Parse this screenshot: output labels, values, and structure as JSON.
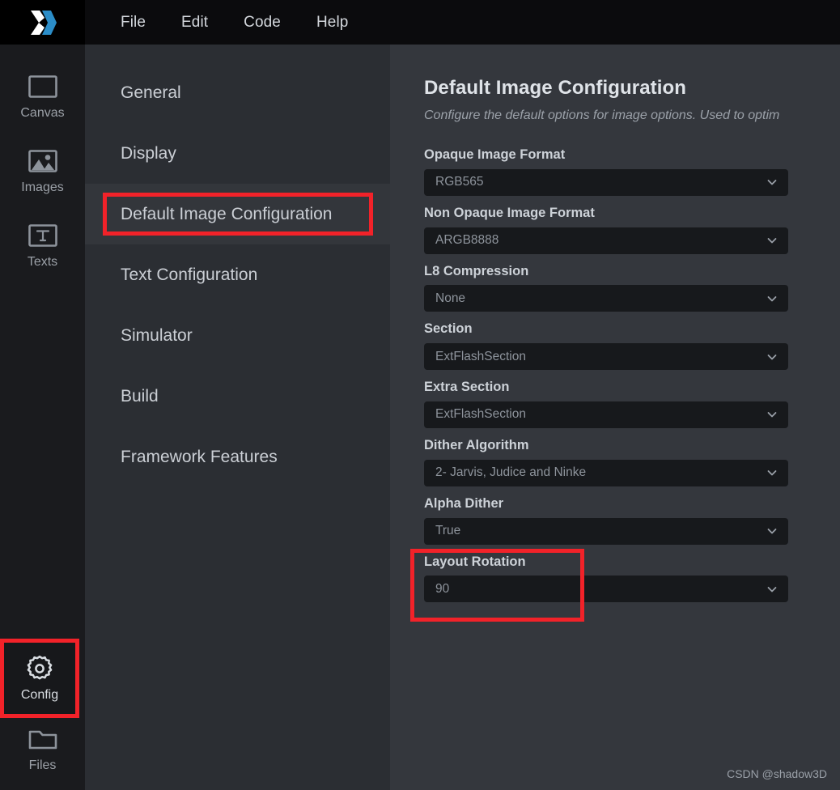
{
  "app": {
    "logo_icon": "x-logo-icon",
    "menu": [
      {
        "label": "File"
      },
      {
        "label": "Edit"
      },
      {
        "label": "Code"
      },
      {
        "label": "Help"
      }
    ]
  },
  "rail": {
    "top_items": [
      {
        "label": "Canvas",
        "icon": "canvas-rect-icon"
      },
      {
        "label": "Images",
        "icon": "image-picture-icon"
      },
      {
        "label": "Texts",
        "icon": "text-t-icon"
      }
    ],
    "bottom_items": [
      {
        "label": "Config",
        "icon": "gear-icon"
      },
      {
        "label": "Files",
        "icon": "folder-icon"
      }
    ]
  },
  "nav": {
    "items": [
      {
        "label": "General"
      },
      {
        "label": "Display"
      },
      {
        "label": "Default Image Configuration"
      },
      {
        "label": "Text Configuration"
      },
      {
        "label": "Simulator"
      },
      {
        "label": "Build"
      },
      {
        "label": "Framework Features"
      }
    ]
  },
  "content": {
    "title": "Default Image Configuration",
    "description": "Configure the default options for image options. Used to optim",
    "fields": [
      {
        "label": "Opaque Image Format",
        "value": "RGB565"
      },
      {
        "label": "Non Opaque Image Format",
        "value": "ARGB8888"
      },
      {
        "label": "L8 Compression",
        "value": "None"
      },
      {
        "label": "Section",
        "value": "ExtFlashSection"
      },
      {
        "label": "Extra Section",
        "value": "ExtFlashSection"
      },
      {
        "label": "Dither Algorithm",
        "value": "2- Jarvis, Judice and Ninke"
      },
      {
        "label": "Alpha Dither",
        "value": "True"
      },
      {
        "label": "Layout Rotation",
        "value": "90"
      }
    ]
  },
  "watermark": {
    "text": "CSDN @shadow3D"
  },
  "colors": {
    "annotation_red": "#f22229",
    "logo_blue": "#2b8dc8",
    "logo_white": "#ffffff",
    "topbar_bg": "#0b0b0d",
    "rail_bg": "#1a1b1e",
    "nav_bg": "#2b2e33",
    "content_bg": "#34373d",
    "select_bg": "#17191c"
  }
}
